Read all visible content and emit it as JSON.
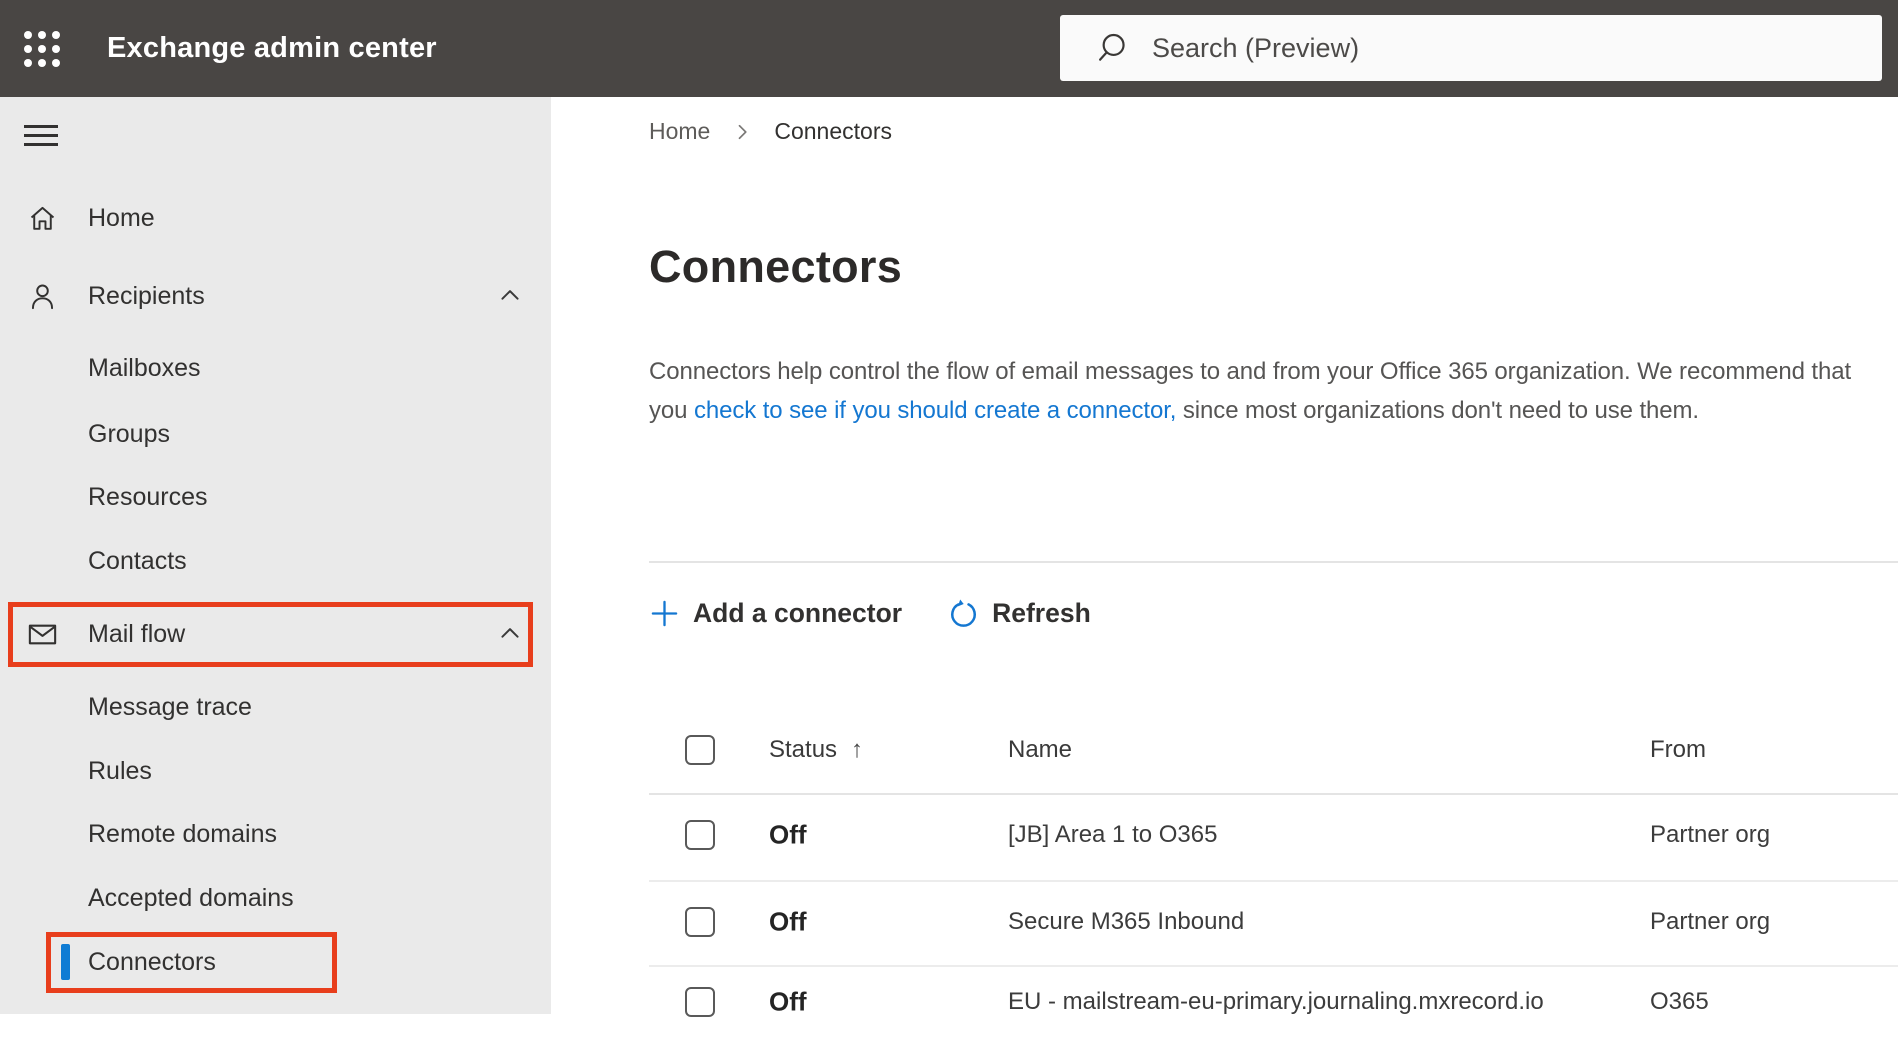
{
  "topbar": {
    "app_title": "Exchange admin center",
    "search_placeholder": "Search (Preview)"
  },
  "sidebar": {
    "items": [
      {
        "label": "Home",
        "type": "top"
      },
      {
        "label": "Recipients",
        "type": "top",
        "expanded": true
      },
      {
        "label": "Mailboxes",
        "type": "sub"
      },
      {
        "label": "Groups",
        "type": "sub"
      },
      {
        "label": "Resources",
        "type": "sub"
      },
      {
        "label": "Contacts",
        "type": "sub"
      },
      {
        "label": "Mail flow",
        "type": "top",
        "expanded": true,
        "annotated": true
      },
      {
        "label": "Message trace",
        "type": "sub"
      },
      {
        "label": "Rules",
        "type": "sub"
      },
      {
        "label": "Remote domains",
        "type": "sub"
      },
      {
        "label": "Accepted domains",
        "type": "sub"
      },
      {
        "label": "Connectors",
        "type": "sub",
        "selected": true,
        "annotated": true
      }
    ]
  },
  "breadcrumb": {
    "home": "Home",
    "current": "Connectors"
  },
  "page": {
    "title": "Connectors",
    "description_part1": "Connectors help control the flow of email messages to and from your Office 365 organization. We recommend that you ",
    "description_link": "check to see if you should create a connector,",
    "description_part2": " since most organizations don't need to use them."
  },
  "toolbar": {
    "add_label": "Add a connector",
    "refresh_label": "Refresh"
  },
  "table": {
    "headers": {
      "status": "Status",
      "name": "Name",
      "from": "From"
    },
    "sort_icon": "↑",
    "rows": [
      {
        "status": "Off",
        "name": "[JB] Area 1 to O365",
        "from": "Partner org"
      },
      {
        "status": "Off",
        "name": "Secure M365 Inbound",
        "from": "Partner org"
      },
      {
        "status": "Off",
        "name": "EU - mailstream-eu-primary.journaling.mxrecord.io",
        "from": "O365"
      }
    ]
  },
  "colors": {
    "topbar_bg": "#494644",
    "sidebar_bg": "#eaeaea",
    "accent_blue": "#1477d1",
    "selection_blue": "#0f7cd4",
    "annotation_red": "#e83e1c"
  },
  "icons": {
    "app_launcher": "waffle-grid",
    "search": "magnifier",
    "nav_menu": "hamburger",
    "home": "house",
    "recipients": "person",
    "mail_flow": "envelope",
    "collapse": "chevron-up",
    "breadcrumb_separator": "chevron-right",
    "add": "plus",
    "refresh": "circular-arrow",
    "sort_ascending": "up-arrow"
  }
}
